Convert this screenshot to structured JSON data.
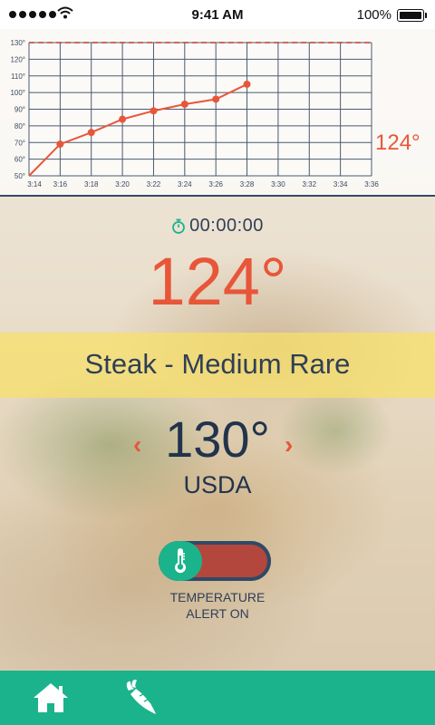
{
  "status_bar": {
    "time": "9:41 AM",
    "battery": "100%",
    "signal_icon": "signal-dots-icon",
    "wifi_icon": "wifi-icon",
    "battery_icon": "battery-icon"
  },
  "chart": {
    "current_reading": "124°",
    "threshold_color": "#c0392b",
    "line_color": "#e8563a"
  },
  "chart_data": {
    "type": "line",
    "x": [
      "3:14",
      "3:16",
      "3:18",
      "3:20",
      "3:22",
      "3:24",
      "3:26",
      "3:28"
    ],
    "x_ticks": [
      "3:14",
      "3:16",
      "3:18",
      "3:20",
      "3:22",
      "3:24",
      "3:26",
      "3:28",
      "3:30",
      "3:32",
      "3:34",
      "3:36"
    ],
    "y_ticks": [
      "50°",
      "60°",
      "70°",
      "80°",
      "90°",
      "100°",
      "110°",
      "120°",
      "130°"
    ],
    "series": [
      {
        "values": [
          50,
          69,
          76,
          84,
          89,
          93,
          96,
          105
        ]
      }
    ],
    "threshold": 130,
    "ylim": [
      50,
      130
    ],
    "grid": true,
    "title": "",
    "xlabel": "",
    "ylabel": ""
  },
  "timer": {
    "value": "00:00:00",
    "icon": "stopwatch-icon"
  },
  "current_temp": "124°",
  "preset": {
    "label": "Steak - Medium Rare"
  },
  "target": {
    "value": "130°",
    "standard": "USDA",
    "prev_icon": "chevron-left-icon",
    "next_icon": "chevron-right-icon",
    "prev_glyph": "‹",
    "next_glyph": "›"
  },
  "alert": {
    "line1": "TEMPERATURE",
    "line2": "ALERT ON",
    "icon": "thermometer-icon"
  },
  "tabbar": {
    "items": [
      {
        "name": "home",
        "icon": "home-icon"
      },
      {
        "name": "food",
        "icon": "carrot-icon"
      }
    ],
    "color": "#1bb38c"
  }
}
